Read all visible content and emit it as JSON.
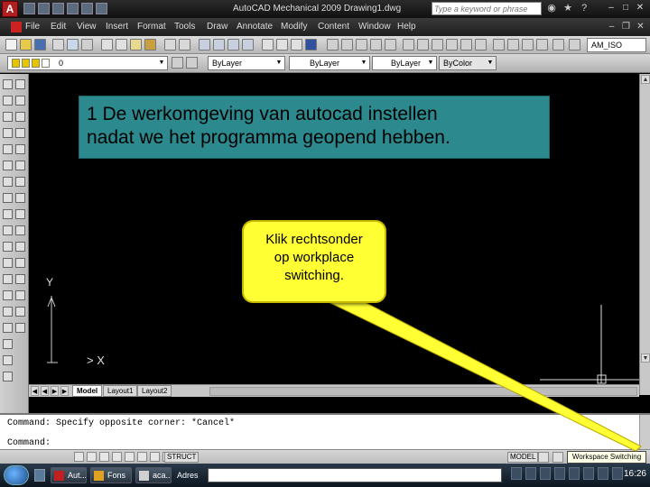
{
  "titlebar": {
    "title": "AutoCAD Mechanical 2009  Drawing1.dwg",
    "search_placeholder": "Type a keyword or phrase"
  },
  "menu": [
    "File",
    "Edit",
    "View",
    "Insert",
    "Format",
    "Tools",
    "Draw",
    "Annotate",
    "Modify",
    "Content",
    "Window",
    "Help"
  ],
  "toolbar": {
    "style_value": "AM_ISO"
  },
  "properties": {
    "layer_value": "0",
    "color_value": "ByLayer",
    "linetype_value": "ByLayer",
    "lineweight_value": "ByLayer",
    "plotstyle_value": "ByColor"
  },
  "callouts": {
    "title_lines": [
      "1 De werkomgeving van autocad instellen",
      "nadat we het programma geopend hebben."
    ],
    "note_lines": [
      "Klik rechtsonder",
      "op workplace",
      "switching."
    ]
  },
  "drawing": {
    "ucs_y": "Y",
    "ucs_x": "> X"
  },
  "layout_tabs": [
    "Model",
    "Layout1",
    "Layout2"
  ],
  "command_line": {
    "history": "Command: Specify opposite corner: *Cancel*",
    "prompt": "Command:"
  },
  "statusbar": {
    "struct": "STRUCT",
    "model": "MODEL",
    "workspace_tooltip": "Workspace Switching"
  },
  "taskbar": {
    "tasks": [
      "Aut...",
      "Fons",
      "aca..."
    ],
    "address_label": "Adres",
    "clock": "16:26"
  }
}
